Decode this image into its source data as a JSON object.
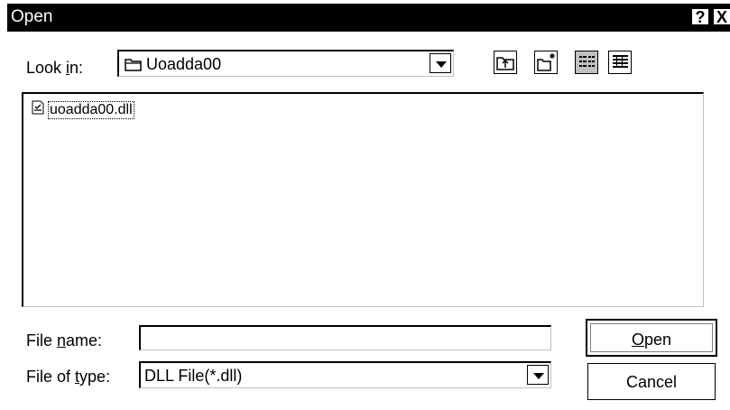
{
  "dialog": {
    "title": "Open",
    "help_glyph": "?",
    "close_glyph": "X"
  },
  "look_in": {
    "label_pre": "Look ",
    "label_accel": "i",
    "label_post": "n:",
    "value": "Uoadda00"
  },
  "toolbar": {
    "icons": [
      "up-one-level-icon",
      "create-new-folder-icon",
      "list-view-icon",
      "details-view-icon"
    ]
  },
  "files": [
    {
      "name": "uoadda00.dll",
      "icon": "dll-file-icon"
    }
  ],
  "file_name": {
    "label_pre": "File ",
    "label_accel": "n",
    "label_post": "ame:",
    "value": ""
  },
  "file_type": {
    "label_pre": "File of ",
    "label_accel": "t",
    "label_post": "ype:",
    "value": "DLL File(*.dll)"
  },
  "buttons": {
    "open_accel": "O",
    "open_rest": "pen",
    "cancel": "Cancel"
  }
}
